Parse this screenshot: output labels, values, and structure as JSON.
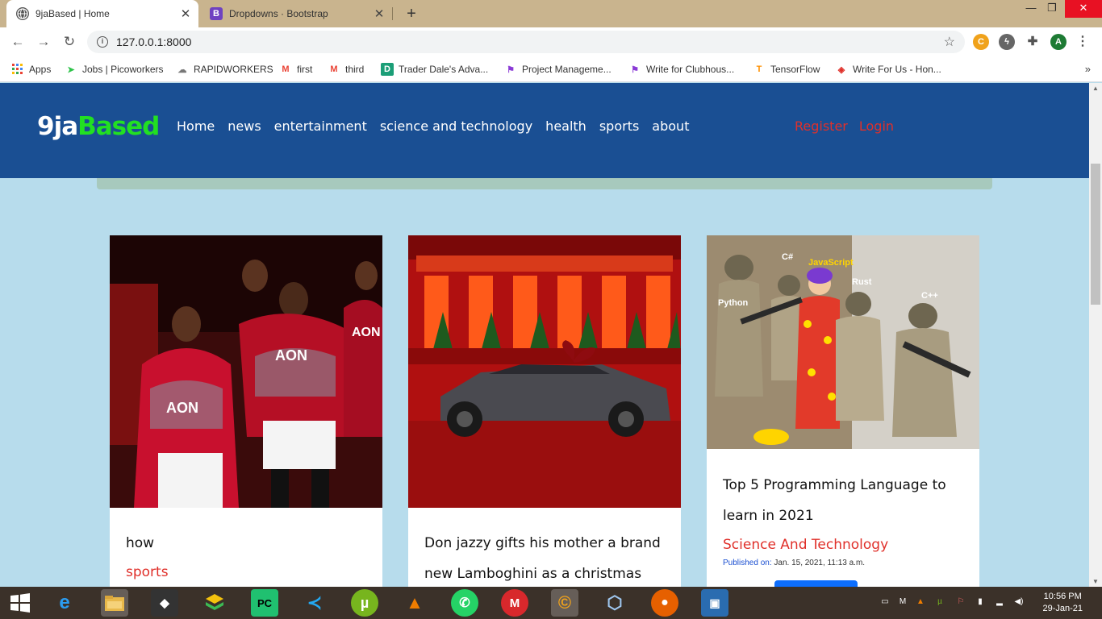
{
  "browser": {
    "tabs": [
      {
        "title": "9jaBased | Home",
        "active": true
      },
      {
        "title": "Dropdowns · Bootstrap",
        "active": false,
        "favicon": "B"
      }
    ],
    "url": "127.0.0.1:8000",
    "profile_initial": "A",
    "bookmarks": [
      {
        "label": "Apps",
        "icon": "apps-grid-icon"
      },
      {
        "label": "Jobs | Picoworkers",
        "icon": "send-icon"
      },
      {
        "label": "RAPIDWORKERS",
        "icon": "cloud-icon"
      },
      {
        "label": "first",
        "icon": "gmail-icon"
      },
      {
        "label": "third",
        "icon": "gmail-icon"
      },
      {
        "label": "Trader Dale's Adva...",
        "icon": "d-icon"
      },
      {
        "label": "Project Manageme...",
        "icon": "flag-icon"
      },
      {
        "label": "Write for Clubhous...",
        "icon": "flag-icon"
      },
      {
        "label": "TensorFlow",
        "icon": "tensorflow-icon"
      },
      {
        "label": "Write For Us - Hon...",
        "icon": "diamond-icon"
      }
    ]
  },
  "site": {
    "brand_part1": "9ja",
    "brand_part2": "Based",
    "nav": [
      "Home",
      "news",
      "entertainment",
      "science and technology",
      "health",
      "sports",
      "about"
    ],
    "auth": {
      "register": "Register",
      "login": "Login"
    },
    "colors": {
      "nav_bg": "#1a4f93",
      "page_bg": "#b7dcec",
      "brand_accent": "#22e022",
      "category": "#e0302a"
    }
  },
  "posts": [
    {
      "title": "how",
      "category": "sports"
    },
    {
      "title": "Don jazzy gifts his mother a brand new Lamboghini as a christmas gift",
      "category": ""
    },
    {
      "title": "Top 5 Programming Language to learn in 2021",
      "category": "Science And Technology",
      "published_label": "Published on:",
      "published_date": "Jan. 15, 2021, 11:13 a.m.",
      "image_labels": [
        "C#",
        "JavaScript",
        "Python",
        "Rust",
        "C++"
      ]
    }
  ],
  "taskbar": {
    "time": "10:56 PM",
    "date": "29-Jan-21"
  }
}
